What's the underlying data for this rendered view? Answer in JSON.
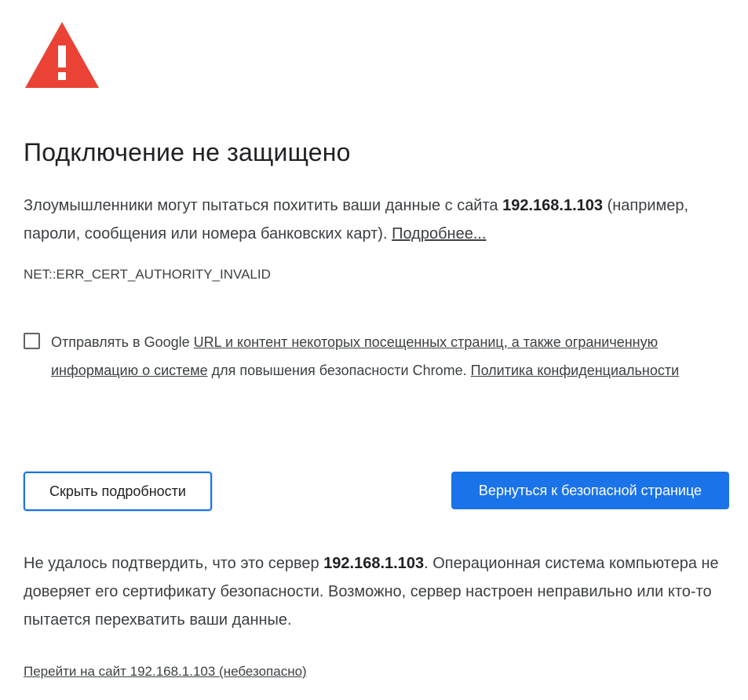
{
  "icon": {
    "name": "warning-triangle-icon",
    "color": "#ea4335",
    "glyph": "!"
  },
  "title": "Подключение не защищено",
  "explanation": {
    "part1": "Злоумышленники могут пытаться похитить ваши данные с сайта ",
    "host": "192.168.1.103",
    "part2": " (например, пароли, сообщения или номера банковских карт). ",
    "learn_more": "Подробнее..."
  },
  "error_code": "NET::ERR_CERT_AUTHORITY_INVALID",
  "optin": {
    "checked": false,
    "prefix": "Отправлять в Google ",
    "link1": "URL и контент некоторых посещенных страниц, а также ограниченную информацию о системе",
    "middle": " для повышения безопасности Chrome. ",
    "privacy_link": "Политика конфиденциальности"
  },
  "buttons": {
    "details_label": "Скрыть подробности",
    "back_label": "Вернуться к безопасной странице"
  },
  "details": {
    "part1": "Не удалось подтвердить, что это сервер ",
    "host": "192.168.1.103",
    "part2": ". Операционная система компьютера не доверяет его сертификату безопасности. Возможно, сервер настроен неправильно или кто-то пытается перехватить ваши данные."
  },
  "proceed_link": "Перейти на сайт 192.168.1.103 (небезопасно)",
  "colors": {
    "accent": "#1a73e8",
    "warning": "#ea4335",
    "text": "#202124",
    "secondary_text": "#3c4043"
  }
}
